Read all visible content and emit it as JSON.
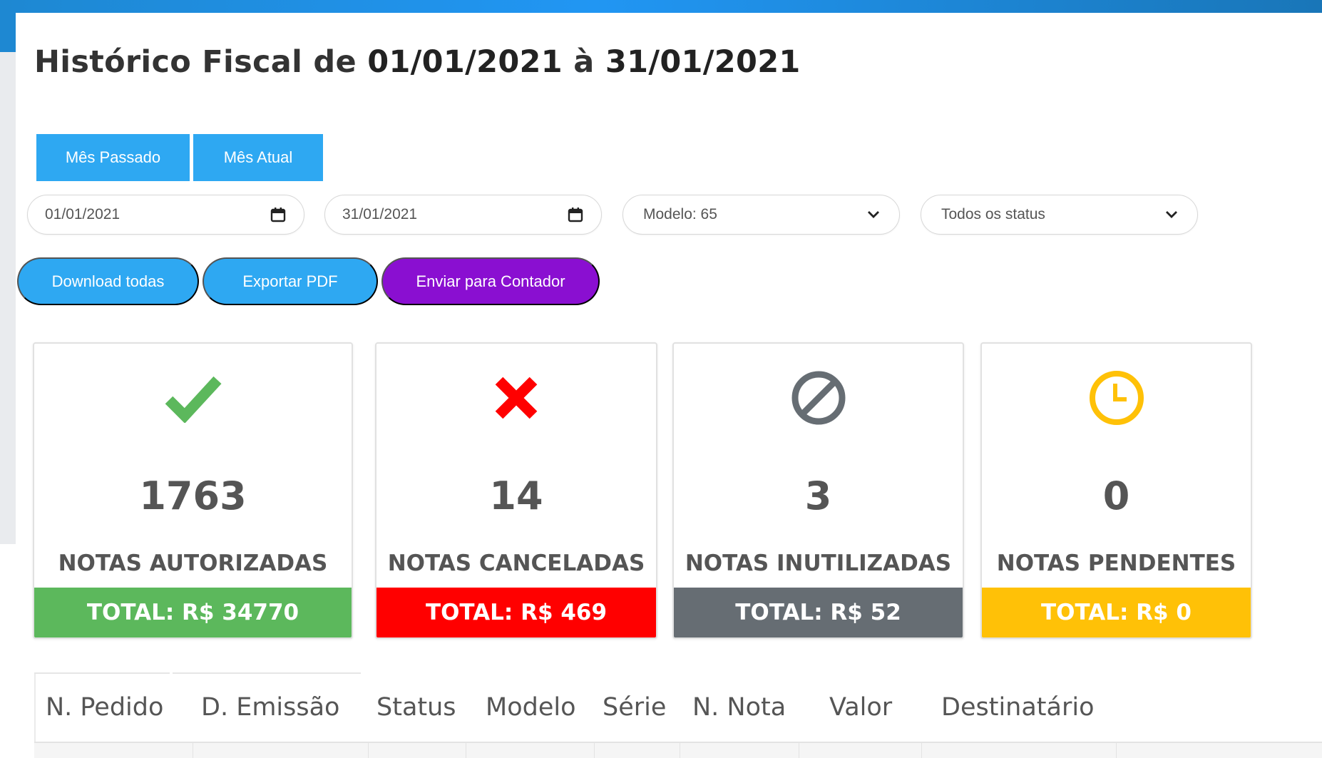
{
  "header": {
    "title_prefix": "Histórico Fiscal de",
    "date_from": "01/01/2021",
    "title_sep": "à",
    "date_to": "31/01/2021"
  },
  "period_buttons": {
    "last_month": "Mês Passado",
    "current_month": "Mês Atual"
  },
  "filters": {
    "start_date": "01/01/2021",
    "end_date": "31/01/2021",
    "model": "Modelo: 65",
    "status": "Todos os status"
  },
  "actions": {
    "download_all": "Download todas",
    "export_pdf": "Exportar PDF",
    "send_accountant": "Enviar para Contador"
  },
  "cards": [
    {
      "count": "1763",
      "label": "NOTAS AUTORIZADAS",
      "total": "TOTAL: R$ 34770",
      "color": "#5cb85c",
      "icon": "check-icon"
    },
    {
      "count": "14",
      "label": "NOTAS CANCELADAS",
      "total": "TOTAL: R$ 469",
      "color": "#ff0000",
      "icon": "x-icon"
    },
    {
      "count": "3",
      "label": "NOTAS INUTILIZADAS",
      "total": "TOTAL: R$ 52",
      "color": "#666d73",
      "icon": "ban-icon"
    },
    {
      "count": "0",
      "label": "NOTAS PENDENTES",
      "total": "TOTAL: R$ 0",
      "color": "#ffc107",
      "icon": "clock-icon"
    }
  ],
  "table": {
    "columns": [
      "N. Pedido",
      "D. Emissão",
      "Status",
      "Modelo",
      "Série",
      "N. Nota",
      "Valor",
      "Destinatário"
    ]
  },
  "colors": {
    "primary": "#2ea8f2",
    "purple": "#8a0fd1",
    "topbar": "#1e88d2"
  }
}
